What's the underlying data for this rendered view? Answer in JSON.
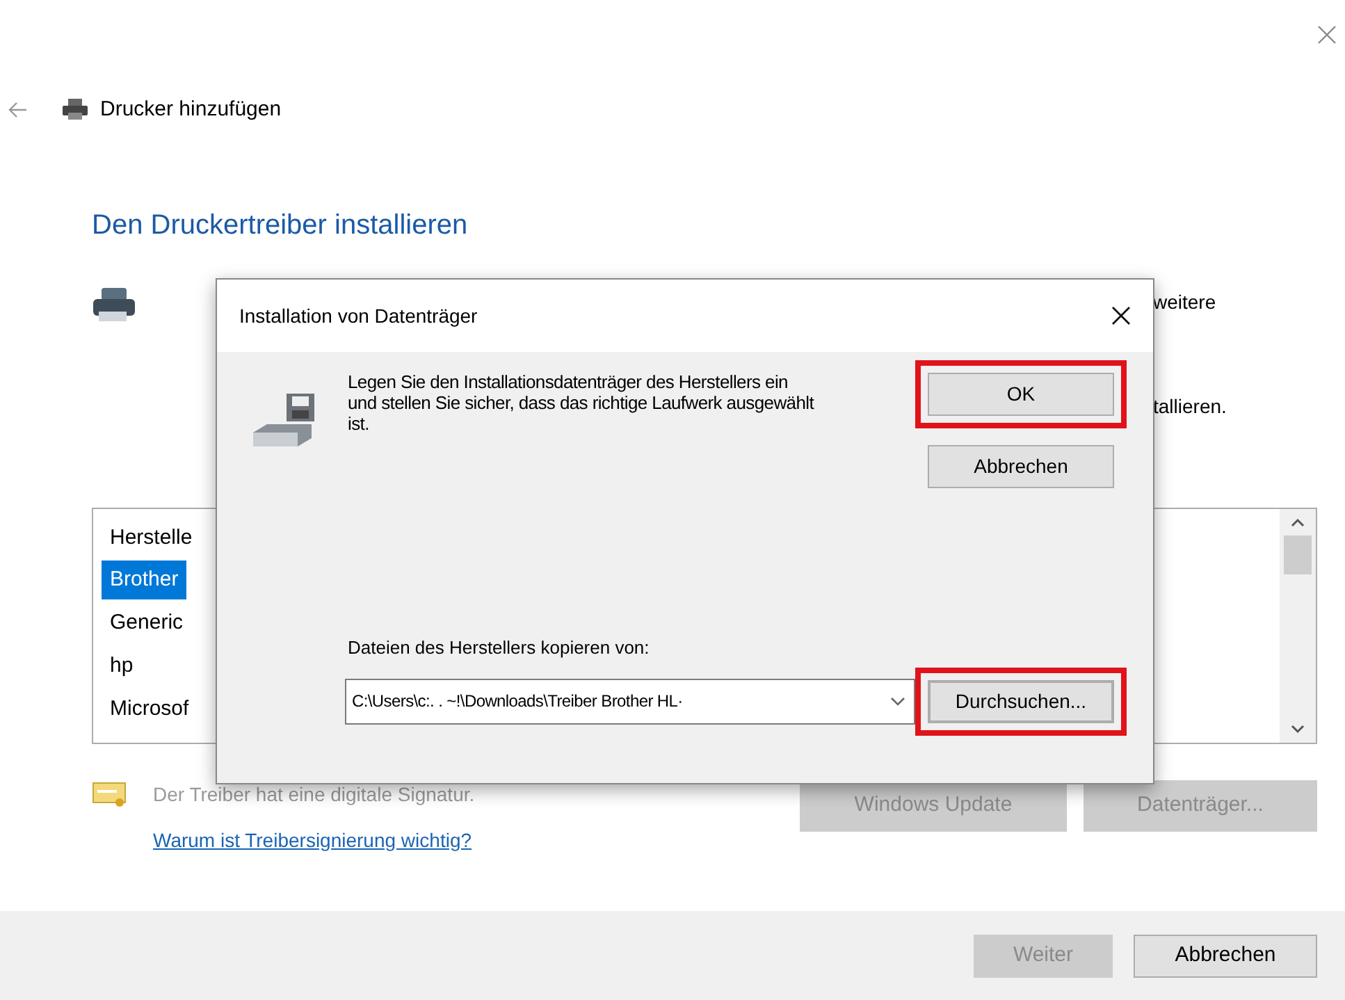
{
  "wizard": {
    "title": "Drucker hinzufügen",
    "heading": "Den Druckertreiber installieren",
    "description_fragments": [
      "weitere",
      "tallieren."
    ],
    "list": {
      "header": "Herstelle",
      "items": [
        {
          "label": "Brother",
          "selected": true
        },
        {
          "label": "Generic",
          "selected": false
        },
        {
          "label": "hp",
          "selected": false
        },
        {
          "label": "Microsof",
          "selected": false
        }
      ]
    },
    "signature_note": "Der Treiber hat eine digitale Signatur.",
    "signature_link": "Warum ist Treibersignierung wichtig?",
    "side_buttons": [
      {
        "label": "Windows Update",
        "disabled": true
      },
      {
        "label": "Datenträger...",
        "disabled": true
      }
    ],
    "footer_buttons": [
      {
        "label": "Weiter",
        "disabled": true
      },
      {
        "label": "Abbrechen",
        "disabled": false
      }
    ]
  },
  "dialog": {
    "title": "Installation von Datenträger",
    "message": "Legen Sie den Installationsdatenträger des Herstellers ein und stellen Sie sicher, dass das richtige Laufwerk ausgewählt ist.",
    "buttons": [
      {
        "label": "OK",
        "highlighted": true
      },
      {
        "label": "Abbrechen",
        "highlighted": false
      }
    ],
    "copy_label": "Dateien des Herstellers kopieren von:",
    "path": "C:\\Users\\c:. . ~!\\Downloads\\Treiber Brother HL·",
    "browse": {
      "label": "Durchsuchen...",
      "highlighted": true
    }
  }
}
